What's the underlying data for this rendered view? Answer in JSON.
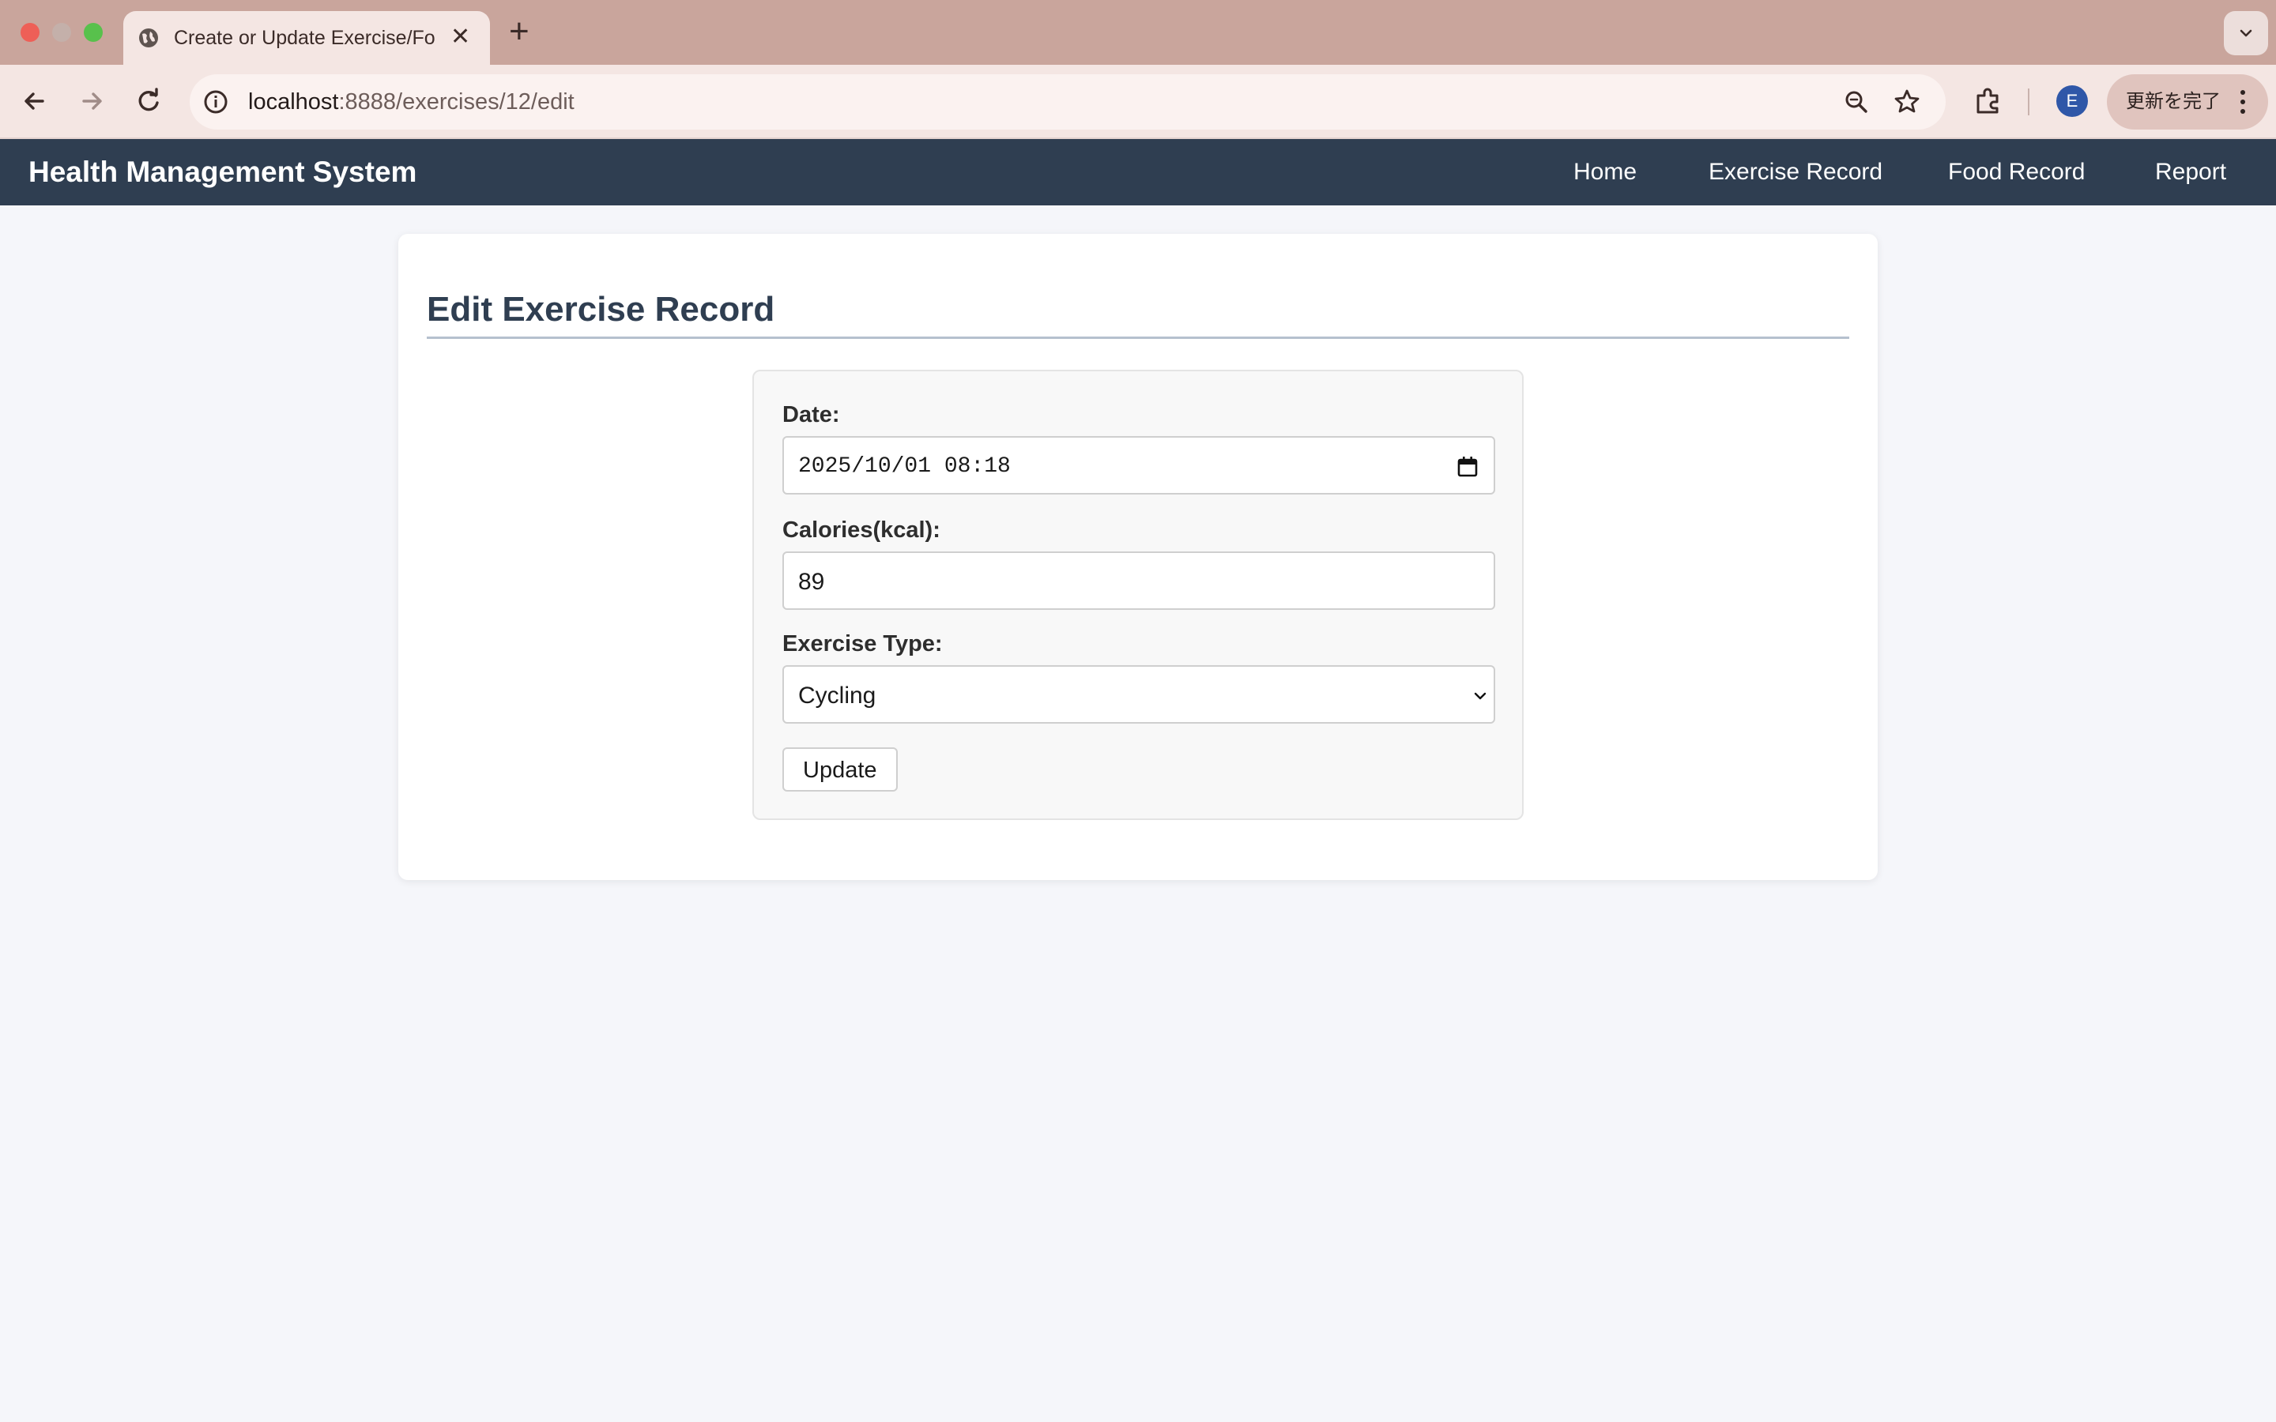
{
  "browser": {
    "tab_title": "Create or Update Exercise/Fo",
    "new_tab_symbol": "+",
    "tab_close_symbol": "✕",
    "url_host": "localhost",
    "url_rest": ":8888/exercises/12/edit",
    "profile_initial": "E",
    "update_button_label": "更新を完了",
    "icons": [
      "globe-icon",
      "back-icon",
      "forward-icon",
      "reload-icon",
      "site-info-icon",
      "zoom-icon",
      "bookmark-star-icon",
      "extensions-icon",
      "kebab-menu-icon",
      "tab-search-chevron-icon"
    ]
  },
  "navbar": {
    "brand": "Health Management System",
    "links": [
      {
        "label": "Home"
      },
      {
        "label": "Exercise Record"
      },
      {
        "label": "Food Record"
      },
      {
        "label": "Report"
      }
    ],
    "background": "#2f3e51"
  },
  "page": {
    "title": "Edit Exercise Record",
    "form": {
      "date_label": "Date:",
      "date_value": "2025/10/01 08:18",
      "calories_label": "Calories(kcal):",
      "calories_value": "89",
      "type_label": "Exercise Type:",
      "type_selected": "Cycling",
      "submit_label": "Update"
    }
  }
}
